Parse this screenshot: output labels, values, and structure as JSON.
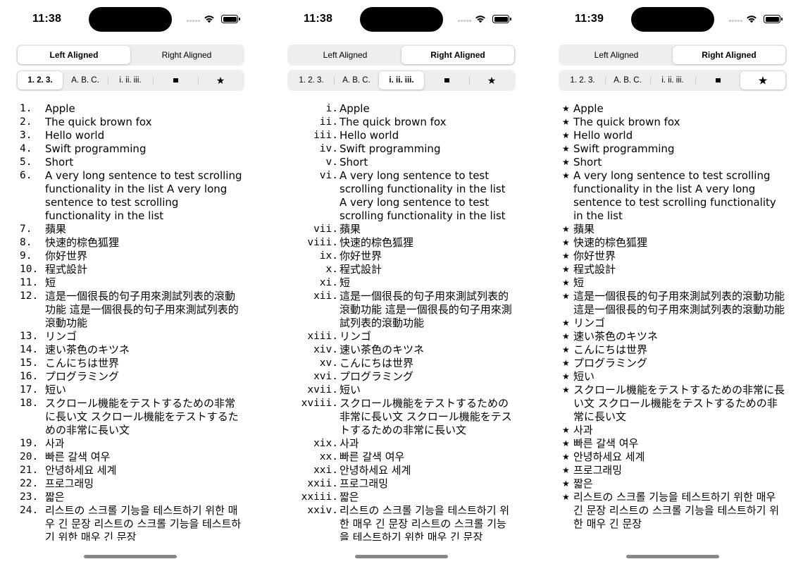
{
  "screens": [
    {
      "time": "11:38",
      "alignment_options": [
        "Left Aligned",
        "Right Aligned"
      ],
      "alignment_selected": 0,
      "marker_options": [
        "1. 2. 3.",
        "A. B. C.",
        "i. ii. iii.",
        "square",
        "star"
      ],
      "marker_selected": 0,
      "markers": [
        "1.",
        "2.",
        "3.",
        "4.",
        "5.",
        "6.",
        "7.",
        "8.",
        "9.",
        "10.",
        "11.",
        "12.",
        "13.",
        "14.",
        "15.",
        "16.",
        "17.",
        "18.",
        "19.",
        "20.",
        "21.",
        "22.",
        "23.",
        "24."
      ]
    },
    {
      "time": "11:38",
      "alignment_options": [
        "Left Aligned",
        "Right Aligned"
      ],
      "alignment_selected": 1,
      "marker_options": [
        "1. 2. 3.",
        "A. B. C.",
        "i. ii. iii.",
        "square",
        "star"
      ],
      "marker_selected": 2,
      "markers": [
        "i.",
        "ii.",
        "iii.",
        "iv.",
        "v.",
        "vi.",
        "vii.",
        "viii.",
        "ix.",
        "x.",
        "xi.",
        "xii.",
        "xiii.",
        "xiv.",
        "xv.",
        "xvi.",
        "xvii.",
        "xviii.",
        "xix.",
        "xx.",
        "xxi.",
        "xxii.",
        "xxiii.",
        "xxiv."
      ]
    },
    {
      "time": "11:39",
      "alignment_options": [
        "Left Aligned",
        "Right Aligned"
      ],
      "alignment_selected": 1,
      "marker_options": [
        "1. 2. 3.",
        "A. B. C.",
        "i. ii. iii.",
        "square",
        "star"
      ],
      "marker_selected": 4,
      "markers": [
        "★",
        "★",
        "★",
        "★",
        "★",
        "★",
        "★",
        "★",
        "★",
        "★",
        "★",
        "★",
        "★",
        "★",
        "★",
        "★",
        "★",
        "★",
        "★",
        "★",
        "★",
        "★",
        "★",
        "★"
      ]
    }
  ],
  "items": [
    "Apple",
    "The quick brown fox",
    "Hello world",
    "Swift programming",
    "Short",
    "A very long sentence to test scrolling functionality in the list A very long sentence to test scrolling functionality in the list",
    "蘋果",
    "快速的棕色狐狸",
    "你好世界",
    "程式設計",
    "短",
    "這是一個很長的句子用來測試列表的滾動功能 這是一個很長的句子用來測試列表的滾動功能",
    "リンゴ",
    "速い茶色のキツネ",
    "こんにちは世界",
    "プログラミング",
    "短い",
    "スクロール機能をテストするための非常に長い文 スクロール機能をテストするための非常に長い文",
    "사과",
    "빠른 갈색 여우",
    "안녕하세요 세계",
    "프로그래밍",
    "짧은",
    "리스트の 스크롤 기능을 테스트하기 위한 매우 긴 문장 리스트の 스크롤 기능을 테스트하기 위한 매우 긴 문장"
  ]
}
